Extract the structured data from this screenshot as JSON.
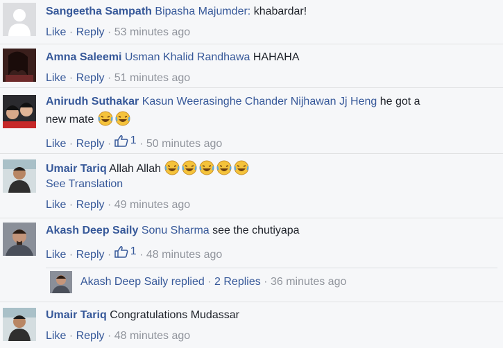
{
  "comments": [
    {
      "author": "Sangeetha Sampath",
      "tags": "Bipasha Majumder:",
      "text": "khabardar!",
      "like": "Like",
      "reply": "Reply",
      "time": "53 minutes ago"
    },
    {
      "author": "Amna Saleemi",
      "tags": "Usman Khalid Randhawa",
      "text": "HAHAHA",
      "like": "Like",
      "reply": "Reply",
      "time": "51 minutes ago"
    },
    {
      "author": "Anirudh Suthakar",
      "tags": "Kasun Weerasinghe Chander Nijhawan Jj Heng",
      "text": "he got a",
      "text2": "new mate",
      "like": "Like",
      "reply": "Reply",
      "likes_count": "1",
      "time": "50 minutes ago",
      "emoji": "laughing-emoji"
    },
    {
      "author": "Umair Tariq",
      "text": "Allah Allah",
      "see_translation": "See Translation",
      "like": "Like",
      "reply": "Reply",
      "time": "49 minutes ago",
      "emoji": "laughing-emoji"
    },
    {
      "author": "Akash Deep Saily",
      "tags": "Sonu Sharma",
      "text": "see the chutiyapa",
      "like": "Like",
      "reply": "Reply",
      "likes_count": "1",
      "time": "48 minutes ago",
      "replies": {
        "author": "Akash Deep Saily",
        "replied": "replied",
        "sep": "·",
        "count": "2 Replies",
        "time": "36 minutes ago"
      }
    },
    {
      "author": "Umair Tariq",
      "text": "Congratulations Mudassar",
      "like": "Like",
      "reply": "Reply",
      "time": "48 minutes ago"
    }
  ],
  "separator": "·",
  "colors": {
    "link": "#365899",
    "meta": "#90949c",
    "background": "#f6f7f9"
  }
}
